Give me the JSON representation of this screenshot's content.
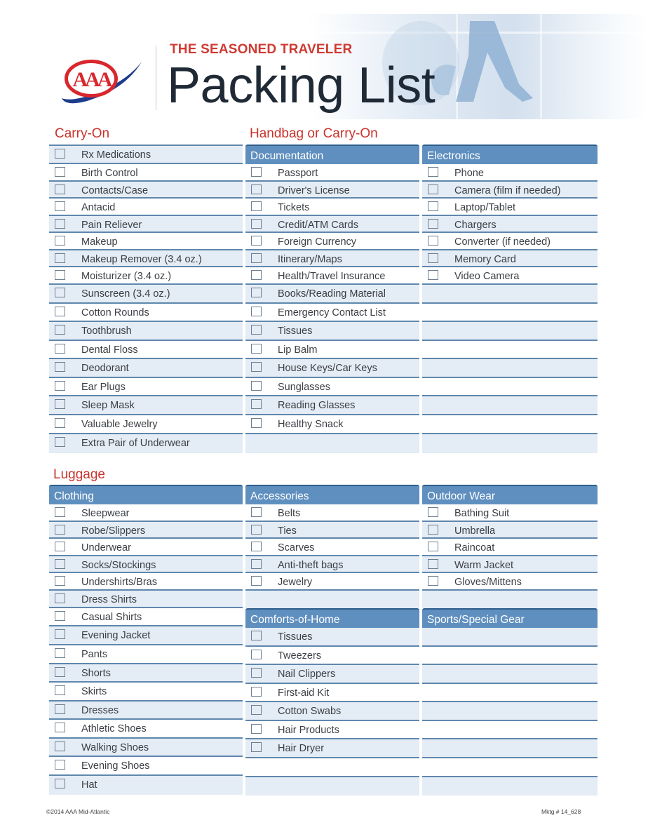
{
  "header": {
    "subtitle": "THE SEASONED TRAVELER",
    "title": "Packing List",
    "logo_text": "AAA",
    "colors": {
      "brand_red": "#cf3a33",
      "brand_blue": "#1e3c8c",
      "title": "#1f2a36"
    }
  },
  "carry_on": {
    "title": "Carry-On",
    "items": [
      "Rx Medications",
      "Birth Control",
      "Contacts/Case",
      "Antacid",
      "Pain Reliever",
      "Makeup",
      "Makeup Remover (3.4 oz.)",
      "Moisturizer (3.4 oz.)",
      "Sunscreen (3.4 oz.)",
      "Cotton Rounds",
      "Toothbrush",
      "Dental Floss",
      "Deodorant",
      "Ear Plugs",
      "Sleep Mask",
      "Valuable Jewelry",
      "Extra Pair of Underwear"
    ]
  },
  "handbag": {
    "title": "Handbag or Carry-On",
    "documentation": {
      "header": "Documentation",
      "items": [
        "Passport",
        "Driver's License",
        "Tickets",
        "Credit/ATM Cards",
        "Foreign Currency",
        "Itinerary/Maps",
        "Health/Travel Insurance",
        "Books/Reading Material",
        "Emergency Contact List",
        "Tissues",
        "Lip Balm",
        "House Keys/Car Keys",
        "Sunglasses",
        "Reading Glasses",
        "Healthy Snack"
      ]
    },
    "electronics": {
      "header": "Electronics",
      "items": [
        "Phone",
        "Camera (film if needed)",
        "Laptop/Tablet",
        "Chargers",
        "Converter (if needed)",
        "Memory Card",
        "Video Camera"
      ]
    }
  },
  "luggage": {
    "title": "Luggage",
    "clothing": {
      "header": "Clothing",
      "items": [
        "Sleepwear",
        "Robe/Slippers",
        "Underwear",
        "Socks/Stockings",
        "Undershirts/Bras",
        "Dress Shirts",
        "Casual Shirts",
        "Evening Jacket",
        "Pants",
        "Shorts",
        "Skirts",
        "Dresses",
        "Athletic Shoes",
        "Walking Shoes",
        "Evening Shoes",
        "Hat"
      ]
    },
    "accessories": {
      "header": "Accessories",
      "items": [
        "Belts",
        "Ties",
        "Scarves",
        "Anti-theft bags",
        "Jewelry"
      ]
    },
    "outdoor_wear": {
      "header": "Outdoor Wear",
      "items": [
        "Bathing Suit",
        "Umbrella",
        "Raincoat",
        "Warm Jacket",
        "Gloves/Mittens"
      ]
    },
    "comforts": {
      "header": "Comforts-of-Home",
      "items": [
        "Tissues",
        "Tweezers",
        "Nail Clippers",
        "First-aid Kit",
        "Cotton Swabs",
        "Hair Products",
        "Hair Dryer"
      ]
    },
    "sports": {
      "header": "Sports/Special Gear",
      "items": []
    }
  },
  "footer": {
    "copyright": "©2014 AAA Mid-Atlantic",
    "code": "Mktg # 14_628"
  }
}
